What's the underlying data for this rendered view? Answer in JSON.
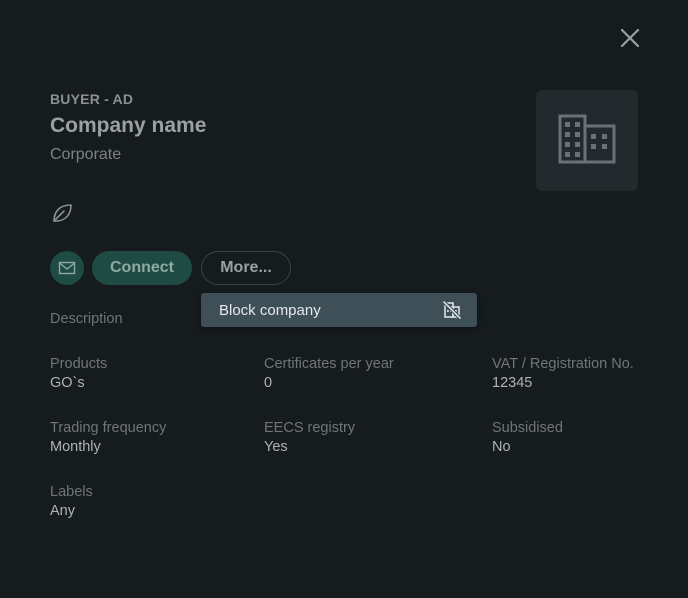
{
  "header": {
    "role_tag": "BUYER - AD",
    "company_name": "Company name",
    "company_type": "Corporate"
  },
  "actions": {
    "connect_label": "Connect",
    "more_label": "More..."
  },
  "more_menu": {
    "items": [
      {
        "label": "Block company",
        "icon": "block-company-icon"
      }
    ]
  },
  "details": {
    "description_label": "Description",
    "products": {
      "label": "Products",
      "value": "GO`s"
    },
    "certificates": {
      "label": "Certificates per year",
      "value": "0"
    },
    "vat": {
      "label": "VAT / Registration No.",
      "value": "12345"
    },
    "trading_frequency": {
      "label": "Trading frequency",
      "value": "Monthly"
    },
    "eecs_registry": {
      "label": "EECS registry",
      "value": "Yes"
    },
    "subsidised": {
      "label": "Subsidised",
      "value": "No"
    },
    "labels": {
      "label": "Labels",
      "value": "Any"
    }
  },
  "icons": {
    "close": "close-icon",
    "logo": "building-icon",
    "leaf": "leaf-icon",
    "mail": "mail-icon"
  },
  "colors": {
    "background": "#161b1e",
    "accent": "#1e4b43",
    "menu_background": "#3f4f58",
    "logo_box": "#222a2e"
  }
}
